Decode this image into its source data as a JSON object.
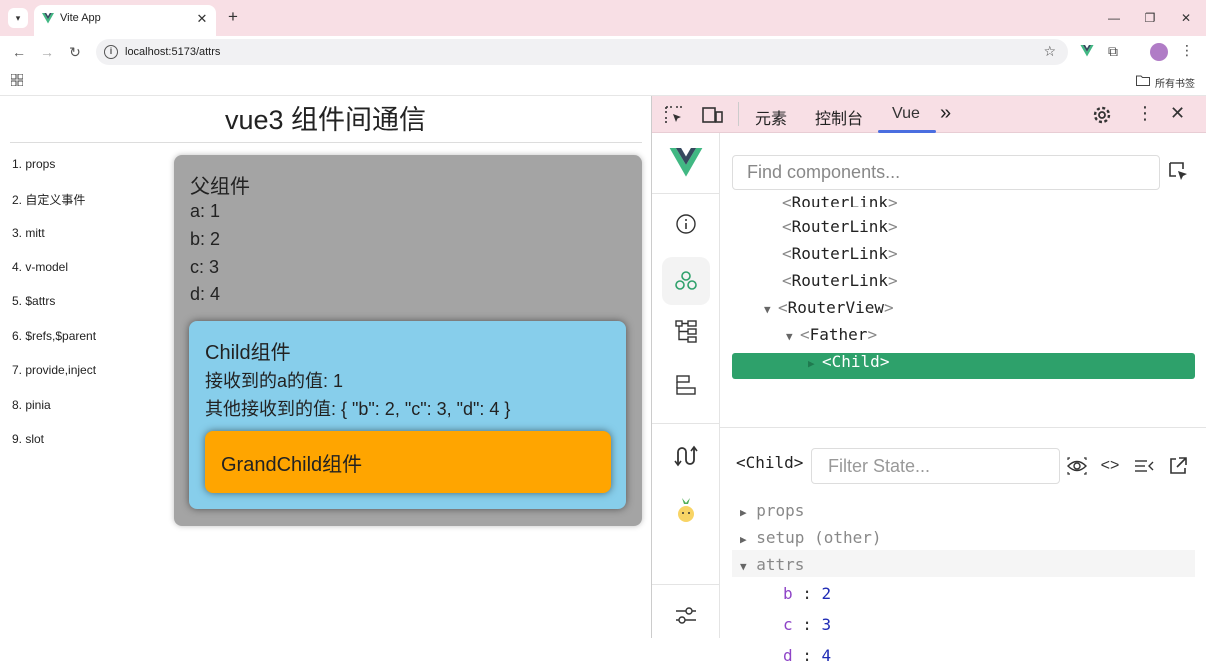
{
  "browser": {
    "tab_title": "Vite App",
    "tab_close": "✕",
    "new_tab": "+",
    "url": "localhost:5173/attrs",
    "bookmarks_folder": "所有书签",
    "window_minimize": "—",
    "window_restore": "❐",
    "window_close": "✕"
  },
  "page": {
    "title": "vue3 组件间通信",
    "nav": [
      "1. props",
      "2. 自定义事件",
      "3. mitt",
      "4. v-model",
      "5. $attrs",
      "6. $refs,$parent",
      "7. provide,inject",
      "8. pinia",
      "9. slot"
    ],
    "father": {
      "title": "父组件",
      "lines": [
        "a: 1",
        "b: 2",
        "c: 3",
        "d: 4"
      ]
    },
    "child": {
      "title": "Child组件",
      "line1": "接收到的a的值: 1",
      "line2": "其他接收到的值: { \"b\": 2, \"c\": 3, \"d\": 4 }"
    },
    "grandchild": {
      "title": "GrandChild组件"
    }
  },
  "devtools": {
    "tabs": {
      "elements": "元素",
      "console": "控制台",
      "vue": "Vue",
      "more": "»"
    },
    "find_placeholder": "Find components...",
    "tree": [
      {
        "name": "RouterLink",
        "depth": 0
      },
      {
        "name": "RouterLink",
        "depth": 0
      },
      {
        "name": "RouterLink",
        "depth": 0
      },
      {
        "name": "RouterLink",
        "depth": 0
      },
      {
        "name": "RouterView",
        "depth": 0,
        "expanded": true
      },
      {
        "name": "Father",
        "depth": 1,
        "expanded": true
      },
      {
        "name": "Child",
        "depth": 2,
        "selected": true
      }
    ],
    "inspector": {
      "component": "<Child>",
      "filter_placeholder": "Filter State...",
      "sections": [
        "props",
        "setup (other)",
        "attrs"
      ],
      "attrs": [
        {
          "key": "b",
          "value": "2"
        },
        {
          "key": "c",
          "value": "3"
        },
        {
          "key": "d",
          "value": "4"
        }
      ]
    }
  },
  "colors": {
    "chrome": "#f8dfe5",
    "father_bg": "#a4a4a4",
    "child_bg": "#87ceeb",
    "grandchild_bg": "#ffa500",
    "selected_row": "#2ea16b",
    "vue_green": "#42b883"
  }
}
